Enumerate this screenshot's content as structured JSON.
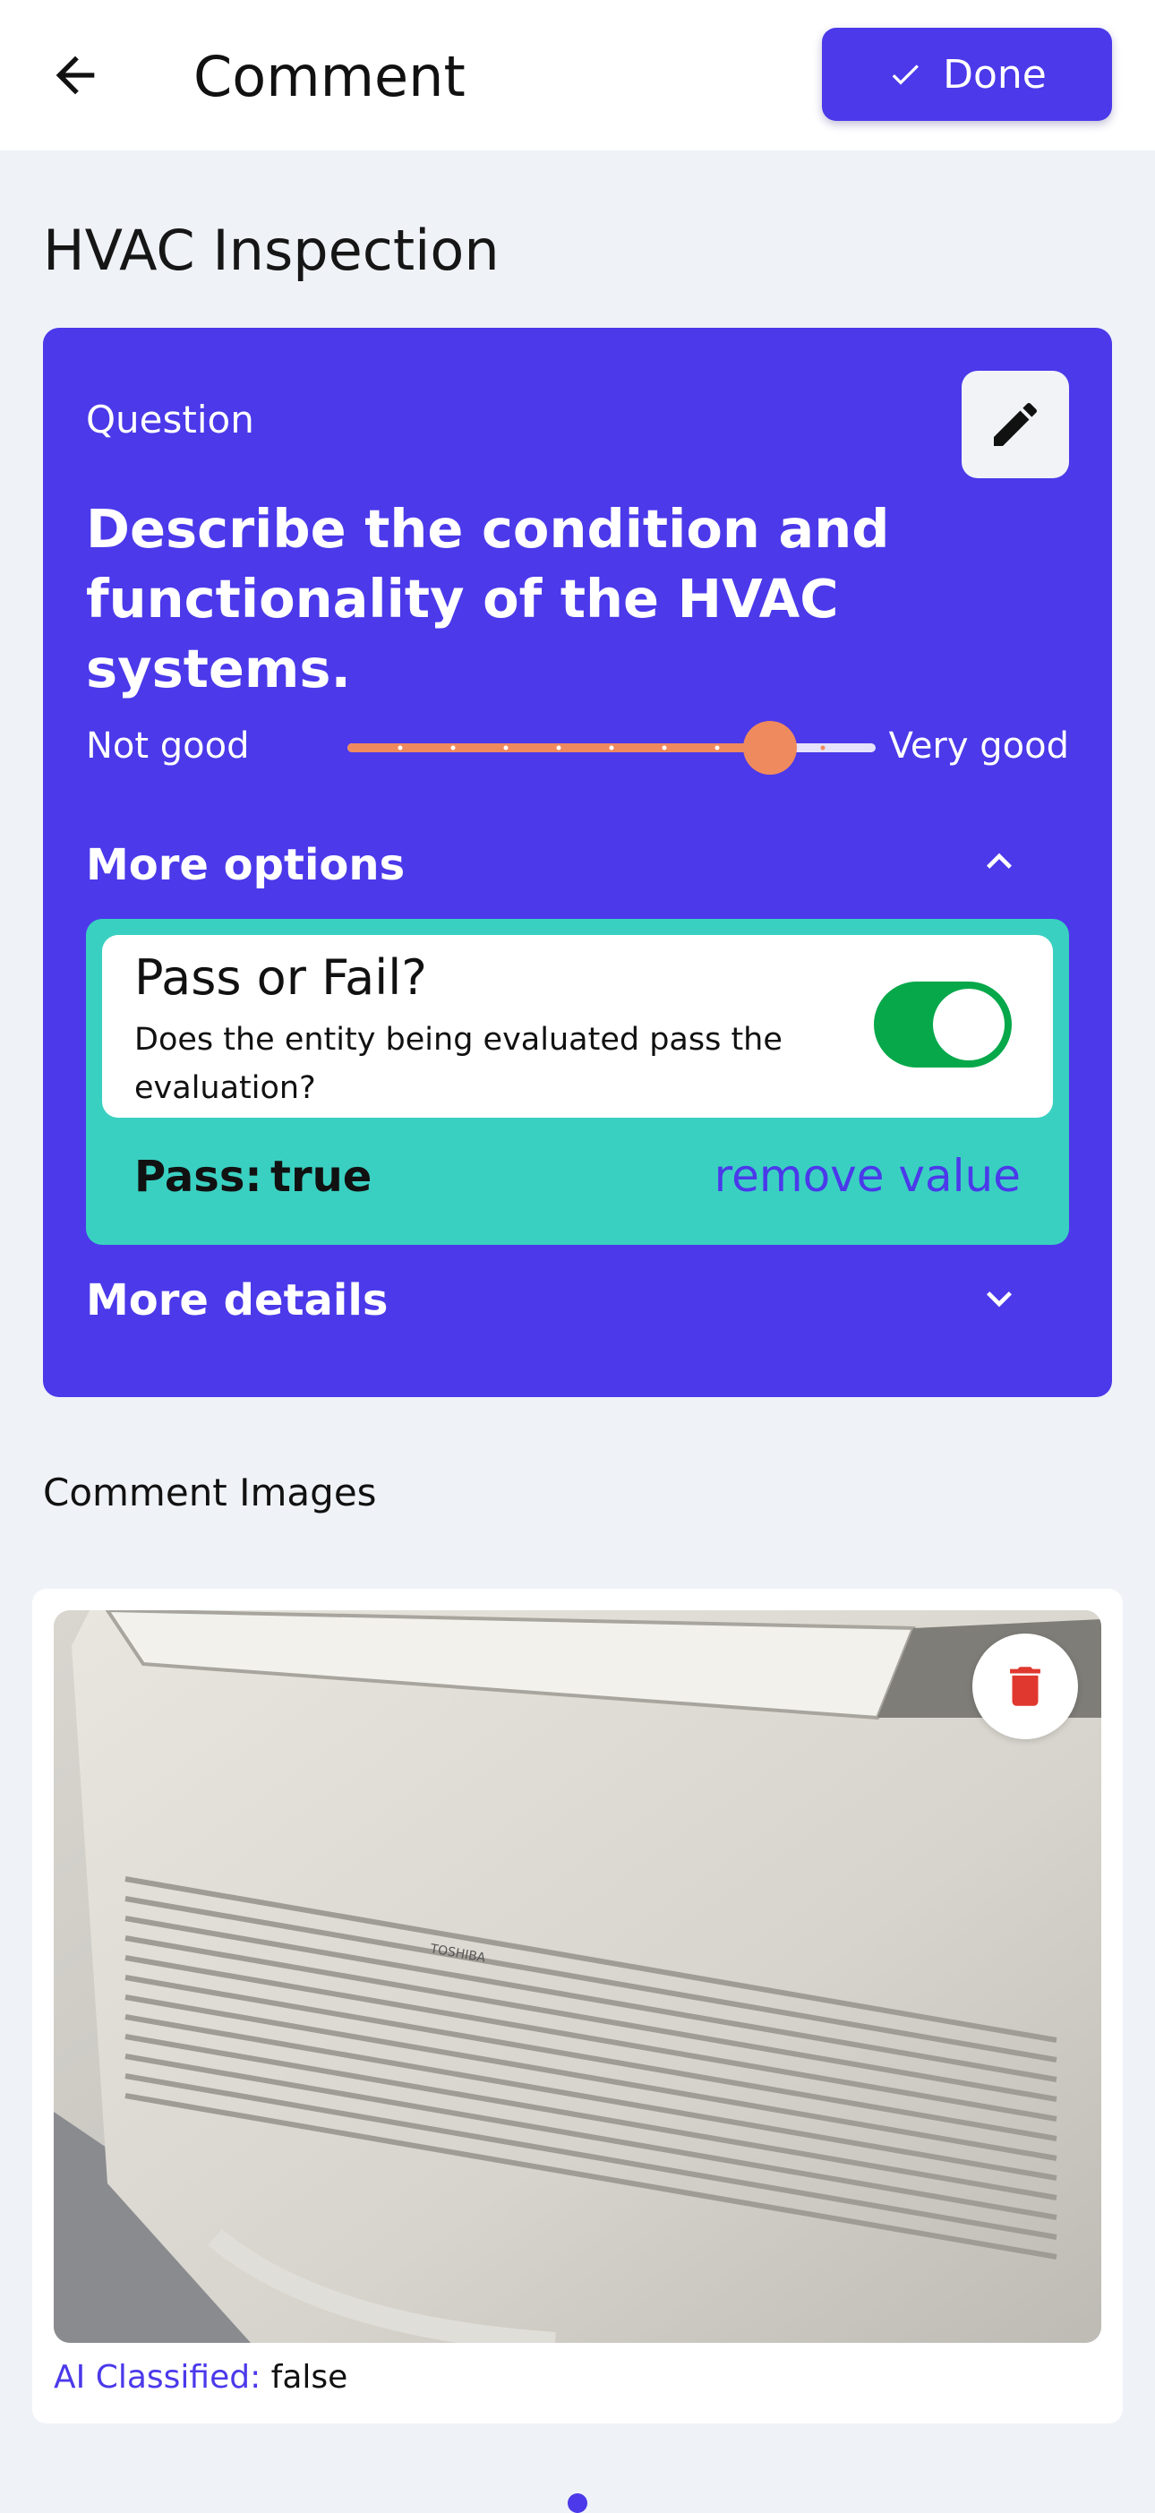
{
  "header": {
    "title": "Comment",
    "done_label": "Done",
    "icons": {
      "back": "arrow-left-icon",
      "done": "check-icon"
    }
  },
  "page": {
    "heading": "HVAC Inspection"
  },
  "question_card": {
    "label": "Question",
    "text": "Describe the condition and functionality of the HVAC systems.",
    "scale_low": "Not good",
    "scale_high": "Very good",
    "rating_fraction": 0.8,
    "more_options_label": "More options",
    "more_details_label": "More details",
    "pass_fail": {
      "title": "Pass or Fail?",
      "description": "Does the entity being evaluated pass the evaluation?",
      "toggle_on": true,
      "result_label": "Pass:",
      "result_value": "true",
      "remove_label": "remove value"
    },
    "colors": {
      "card": "#4b39ea",
      "accent_teal": "#3ad0c1",
      "slider": "#ef8a5e",
      "toggle": "#07a84a"
    }
  },
  "images_section": {
    "label": "Comment Images",
    "ai_classified_label": "AI Classified:",
    "ai_classified_value": "false",
    "photo_text": "TOSHIBA",
    "icons": {
      "delete": "trash-icon"
    }
  }
}
